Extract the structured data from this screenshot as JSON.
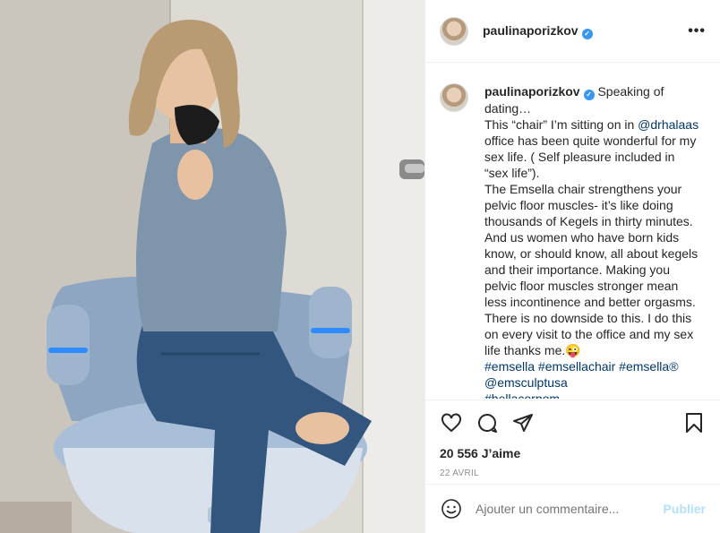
{
  "post": {
    "username": "paulinaporizkov",
    "verified_glyph": "✓",
    "more_glyph": "•••"
  },
  "caption": {
    "username": "paulinaporizkov",
    "parts": [
      " Speaking of dating…",
      "This “chair” I’m sitting on in ",
      "@drhalaas",
      " office has been quite wonderful for my sex life. ( Self pleasure included in “sex life”).",
      "The Emsella chair strengthens your pelvic floor muscles- it’s like doing thousands of Kegels in thirty minutes. And us women who have born kids know, or should know, all about kegels and their importance. Making you pelvic floor muscles stronger mean less incontinence and better orgasms. There is no downside to this. I do this on every visit to the office and my sex life thanks me.😜",
      "#emsella #emsellachair #emsella® @emsculptusa",
      "#bellacorpom"
    ]
  },
  "actions": {
    "icons": [
      "heart-icon",
      "comment-icon",
      "share-icon",
      "bookmark-icon"
    ],
    "likes": "20 556 J’aime",
    "date": "22 avril"
  },
  "comment": {
    "placeholder": "Ajouter un commentaire...",
    "publish_label": "Publier"
  },
  "colors": {
    "verified": "#3897f0",
    "link": "#00376b",
    "publish_disabled": "#b2dffc",
    "chair_glow": "#2f8cff"
  }
}
